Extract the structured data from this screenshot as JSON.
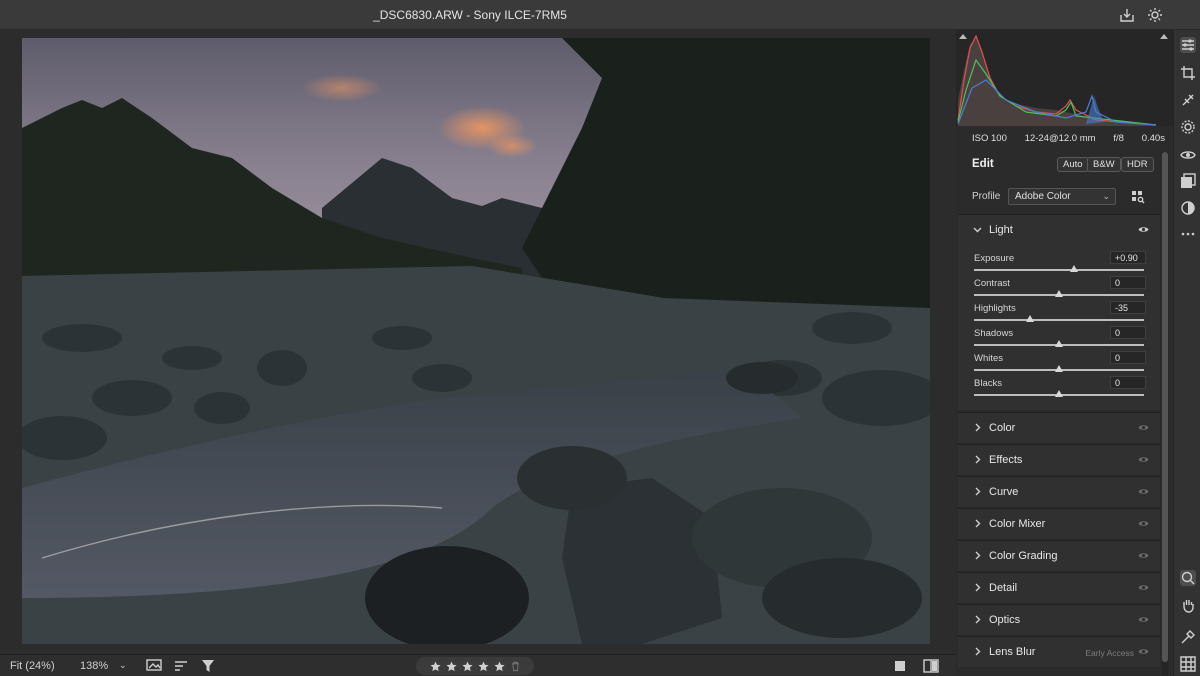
{
  "window": {
    "title": "_DSC6830.ARW  -  Sony ILCE-7RM5"
  },
  "bottom_bar": {
    "fit": "Fit (24%)",
    "zoom": "138%",
    "rating": 0,
    "rating_max": 5
  },
  "meta": {
    "iso": "ISO 100",
    "focal": "12-24@12.0 mm",
    "aperture": "f/8",
    "shutter": "0.40s"
  },
  "edit": {
    "title": "Edit",
    "auto": "Auto",
    "bw": "B&W",
    "hdr": "HDR"
  },
  "profile": {
    "label": "Profile",
    "value": "Adobe Color"
  },
  "light": {
    "label": "Light",
    "sliders": [
      {
        "label": "Exposure",
        "value": "+0.90",
        "fraction": 0.59
      },
      {
        "label": "Contrast",
        "value": "0",
        "fraction": 0.5
      },
      {
        "label": "Highlights",
        "value": "-35",
        "fraction": 0.33
      },
      {
        "label": "Shadows",
        "value": "0",
        "fraction": 0.5
      },
      {
        "label": "Whites",
        "value": "0",
        "fraction": 0.5
      },
      {
        "label": "Blacks",
        "value": "0",
        "fraction": 0.5
      }
    ]
  },
  "groups": [
    {
      "label": "Color"
    },
    {
      "label": "Effects"
    },
    {
      "label": "Curve"
    },
    {
      "label": "Color Mixer"
    },
    {
      "label": "Color Grading"
    },
    {
      "label": "Detail"
    },
    {
      "label": "Optics"
    },
    {
      "label": "Lens Blur",
      "badge": "Early Access"
    }
  ],
  "icons": {
    "titlebar": [
      "save-icon",
      "gear-icon"
    ],
    "tools_top": [
      "edit-sliders-icon",
      "crop-icon",
      "healing-icon",
      "masking-icon",
      "red-eye-icon",
      "presets-icon",
      "snapshots-icon",
      "more-icon"
    ],
    "tools_bottom": [
      "zoom-icon",
      "hand-icon",
      "eyedropper-icon",
      "grid-icon"
    ]
  },
  "colors": {
    "panel": "#2b2b2b",
    "accent_histogram_red": "#e05050",
    "accent_histogram_blue": "#4a7fd0",
    "accent_histogram_green": "#4ec05a"
  }
}
